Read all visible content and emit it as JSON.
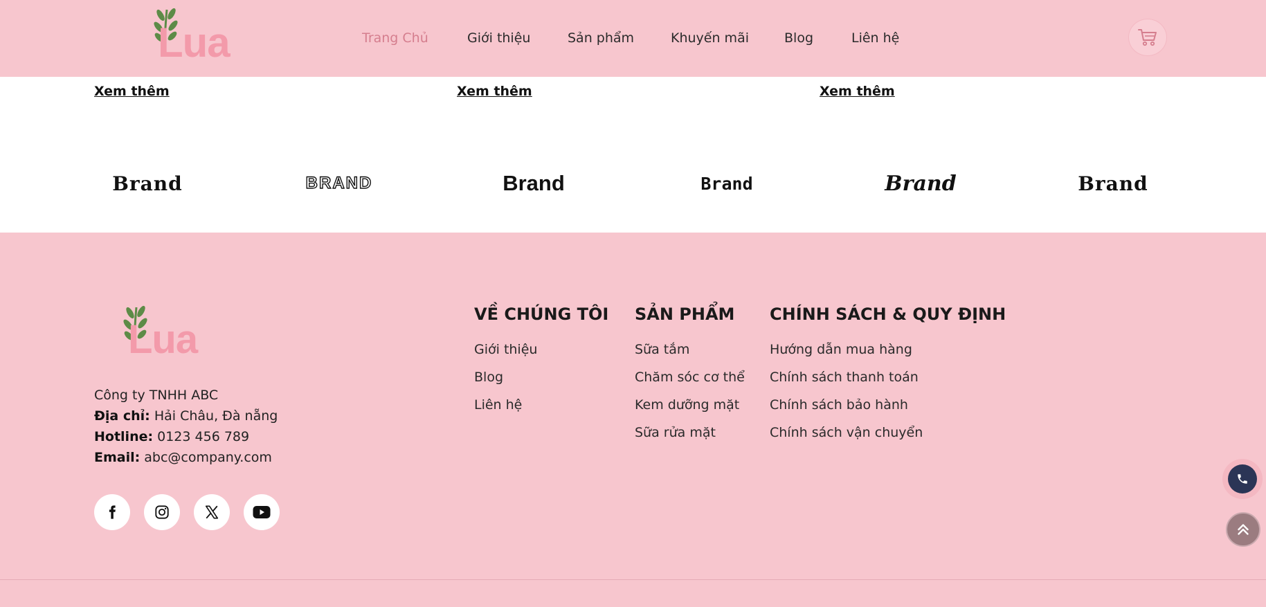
{
  "colors": {
    "pink_bg": "#f7c6ce",
    "logo_pink": "#f39aaa",
    "leaf_green": "#5d8b47",
    "nav_active": "#d57e8e",
    "phone_button": "#2b3556",
    "scroll_top_button": "#9b7c80"
  },
  "header": {
    "logo_text": "Lua",
    "nav": [
      {
        "label": "Trang Chủ",
        "active": true
      },
      {
        "label": "Giới thiệu"
      },
      {
        "label": "Sản phẩm"
      },
      {
        "label": "Khuyến mãi"
      },
      {
        "label": "Blog"
      },
      {
        "label": "Liên hệ"
      }
    ],
    "cart_icon": "cart-icon"
  },
  "more_links": [
    "Xem thêm",
    "Xem thêm",
    "Xem thêm"
  ],
  "brands": [
    "Brand",
    "BRAND",
    "Brand",
    "Brand",
    "Brand",
    "Brand"
  ],
  "footer": {
    "logo_text": "Lua",
    "company_name": "Công ty TNHH ABC",
    "address_label": "Địa chỉ:",
    "address": "Hải Châu, Đà nẵng",
    "hotline_label": "Hotline:",
    "hotline": "0123 456 789",
    "email_label": "Email:",
    "email": "abc@company.com",
    "social": [
      "facebook-icon",
      "instagram-icon",
      "x-icon",
      "youtube-icon"
    ],
    "columns": [
      {
        "title": "VỀ CHÚNG TÔI",
        "links": [
          "Giới thiệu",
          "Blog",
          "Liên hệ"
        ]
      },
      {
        "title": "SẢN PHẨM",
        "links": [
          "Sữa tắm",
          "Chăm sóc cơ thể",
          "Kem dưỡng mặt",
          "Sữa rửa mặt"
        ]
      },
      {
        "title": "CHÍNH SÁCH & QUY ĐỊNH",
        "links": [
          "Hướng dẫn mua hàng",
          "Chính sách thanh toán",
          "Chính sách bảo hành",
          "Chính sách vận chuyển"
        ]
      }
    ]
  },
  "floating": {
    "phone_icon": "phone-icon",
    "scroll_top_icon": "double-chevron-up-icon"
  }
}
